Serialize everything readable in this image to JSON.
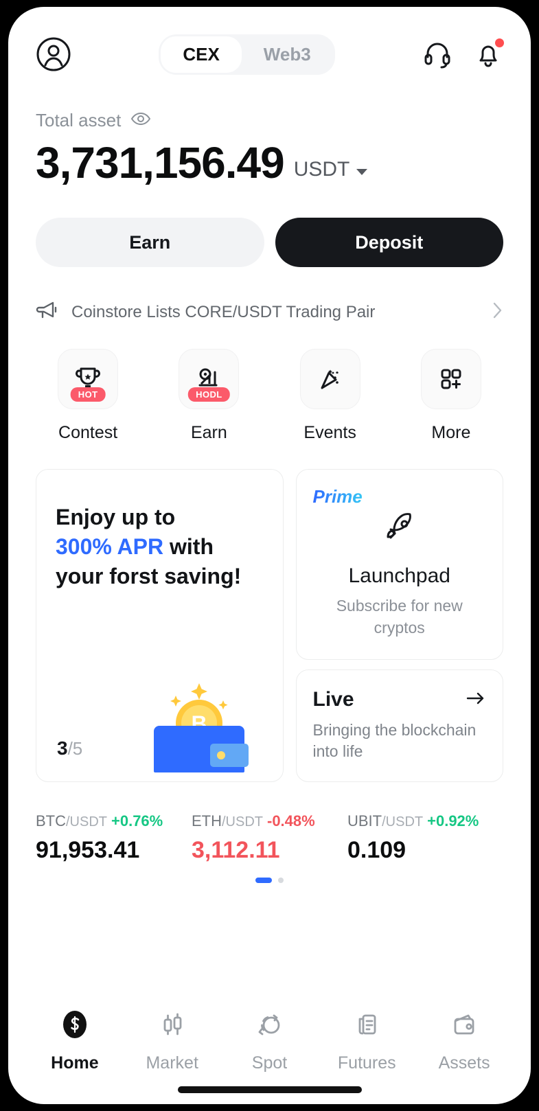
{
  "header": {
    "avatar_icon": "user-circle-icon",
    "tabs": [
      {
        "label": "CEX",
        "active": true
      },
      {
        "label": "Web3",
        "active": false
      }
    ],
    "support_icon": "headset-icon",
    "notification_icon": "bell-icon",
    "notification_has_badge": true
  },
  "balance": {
    "label": "Total asset",
    "eye_icon": "eye-icon",
    "amount": "3,731,156.49",
    "currency": "USDT",
    "currency_caret_icon": "chevron-down-icon"
  },
  "actions": {
    "earn_label": "Earn",
    "deposit_label": "Deposit"
  },
  "announcement": {
    "icon": "megaphone-icon",
    "text": "Coinstore Lists CORE/USDT Trading Pair",
    "chevron_icon": "chevron-right-icon"
  },
  "quick_actions": [
    {
      "label": "Contest",
      "icon": "trophy-icon",
      "badge": "HOT"
    },
    {
      "label": "Earn",
      "icon": "growth-chart-icon",
      "badge": "HODL"
    },
    {
      "label": "Events",
      "icon": "party-popper-icon",
      "badge": ""
    },
    {
      "label": "More",
      "icon": "grid-plus-icon",
      "badge": ""
    }
  ],
  "promo_saving": {
    "line1": "Enjoy up to",
    "highlight": "300% APR",
    "line2_rest": " with",
    "line3": "your forst saving!",
    "highlight_color": "#2f6bff",
    "carousel_current": "3",
    "carousel_total": "/5",
    "illustration": "wallet-with-bitcoin-coin-icon"
  },
  "launchpad": {
    "tag": "Prime",
    "icon": "rocket-icon",
    "title": "Launchpad",
    "subtitle": "Subscribe for new cryptos"
  },
  "live": {
    "title": "Live",
    "arrow_icon": "arrow-right-icon",
    "subtitle": "Bringing the blockchain into life"
  },
  "tickers": [
    {
      "base": "BTC",
      "quote": "/USDT",
      "change": "+0.76%",
      "direction": "up",
      "price": "91,953.41",
      "price_color": "dark"
    },
    {
      "base": "ETH",
      "quote": "/USDT",
      "change": "-0.48%",
      "direction": "down",
      "price": "3,112.11",
      "price_color": "red"
    },
    {
      "base": "UBIT",
      "quote": "/USDT",
      "change": "+0.92%",
      "direction": "up",
      "price": "0.109",
      "price_color": "dark"
    }
  ],
  "ticker_pager": {
    "active_index": 0,
    "count": 2
  },
  "bottom_nav": [
    {
      "label": "Home",
      "icon": "coinstore-logo-icon",
      "active": true
    },
    {
      "label": "Market",
      "icon": "candlestick-icon",
      "active": false
    },
    {
      "label": "Spot",
      "icon": "swap-circles-icon",
      "active": false
    },
    {
      "label": "Futures",
      "icon": "document-chart-icon",
      "active": false
    },
    {
      "label": "Assets",
      "icon": "wallet-icon",
      "active": false
    }
  ],
  "colors": {
    "accent_blue": "#2f6bff",
    "up_green": "#16c784",
    "down_red": "#f2545b",
    "badge_red": "#fb5a6a",
    "dark": "#16181c"
  }
}
